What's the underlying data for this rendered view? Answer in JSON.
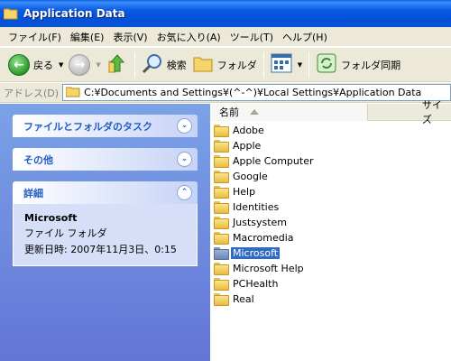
{
  "window": {
    "title": "Application Data"
  },
  "menu": [
    "ファイル(F)",
    "編集(E)",
    "表示(V)",
    "お気に入り(A)",
    "ツール(T)",
    "ヘルプ(H)"
  ],
  "toolbar": {
    "back": "戻る",
    "search": "検索",
    "folders": "フォルダ",
    "sync": "フォルダ同期"
  },
  "address": {
    "label": "アドレス(D)",
    "path": "C:¥Documents and Settings¥(^-^)¥Local Settings¥Application Data"
  },
  "taskpane": {
    "file_tasks": "ファイルとフォルダのタスク",
    "other": "その他",
    "details": {
      "title": "詳細",
      "name": "Microsoft",
      "type": "ファイル フォルダ",
      "modified": "更新日時: 2007年11月3日、0:15"
    }
  },
  "columns": {
    "name": "名前",
    "size": "サイズ"
  },
  "files": [
    "Adobe",
    "Apple",
    "Apple Computer",
    "Google",
    "Help",
    "Identities",
    "Justsystem",
    "Macromedia",
    "Microsoft",
    "Microsoft Help",
    "PCHealth",
    "Real"
  ],
  "selected_file": "Microsoft",
  "colors": {
    "titlebar": "#0a54d6",
    "taskpane": "#7ba2e7",
    "selection": "#316ac5"
  }
}
